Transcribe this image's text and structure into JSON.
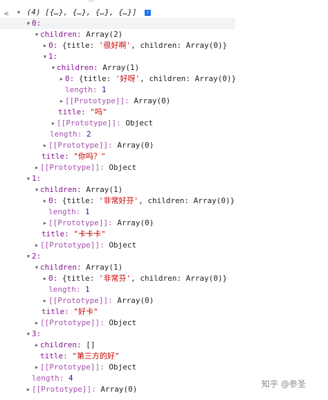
{
  "header_cut": {
    "glyph1": "×",
    "glyph2": "楼"
  },
  "summary": {
    "back": "<",
    "count": "(4)",
    "preview": "[{…}, {…}, {…}, {…}]",
    "info": "i"
  },
  "tree": {
    "k0": "0:",
    "children": "children:",
    "arr2": "Array(2)",
    "arr1": "Array(1)",
    "arr0": "Array(0)",
    "empty": "[]",
    "sub0": "0:",
    "sub1": "1:",
    "title_key": "title:",
    "length_key": "length:",
    "proto": "[[Prototype]]:",
    "obj": "Object",
    "preview_open": "{title: ",
    "preview_mid": ", children: ",
    "preview_close": "}",
    "s_henhaoa": "'很好啊'",
    "s_haoya": "'好呀'",
    "t_ma": "\"吗\"",
    "n1": "1",
    "n2": "2",
    "n4": "4",
    "t_nima": "\"你吗？\"",
    "k1": "1:",
    "s_feichanghaofen": "'非常好芬'",
    "t_kakaka": "\"卡卡卡\"",
    "k2": "2:",
    "s_feichangfen": "'非常芬'",
    "t_haoka": "\"好卡\"",
    "k3": "3:",
    "t_disanfang": "\"第三方的好\""
  },
  "watermark": "知乎 @参圣"
}
